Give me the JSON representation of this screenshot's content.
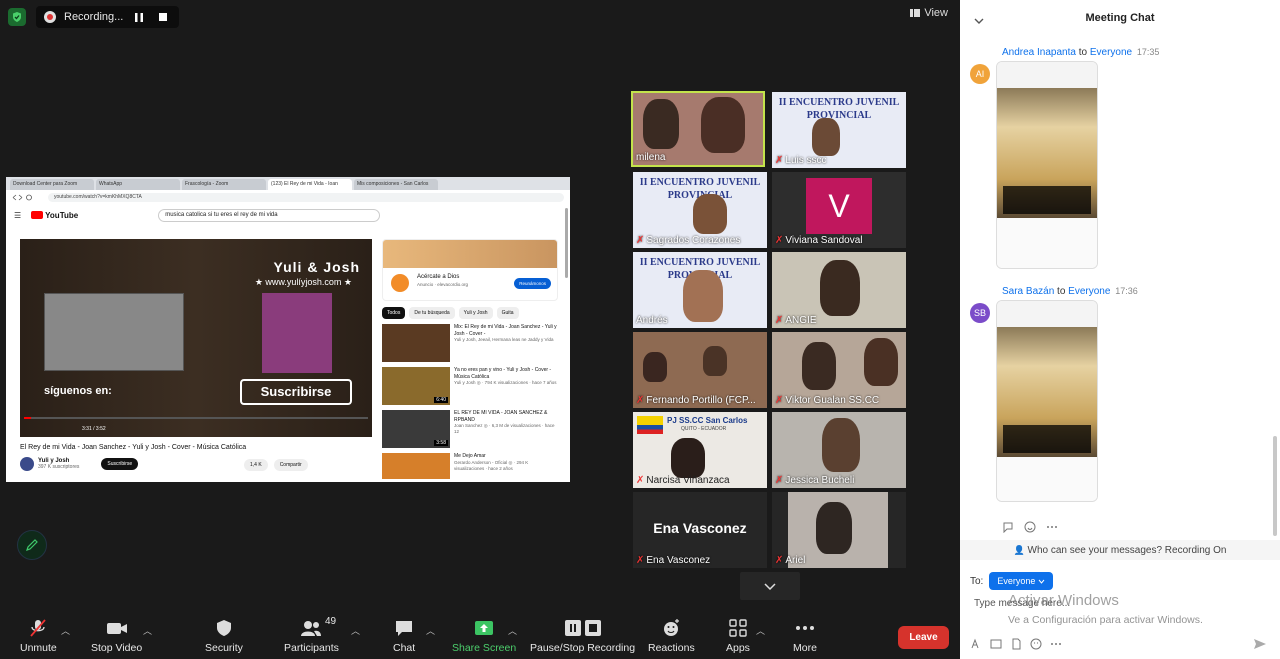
{
  "recording": {
    "label": "Recording..."
  },
  "view_label": "View",
  "browser": {
    "tabs": [
      "Download Center para Zoom",
      "WhatsApp",
      "Frascología - Zoom",
      "(123) El Rey de mi Vida - Ioan",
      "Mis composiciones - San Carlos"
    ],
    "url": "youtube.com/watch?v=kmKhMXQ8CTA"
  },
  "youtube": {
    "logo": "YouTube",
    "search": "musica catolica si tu eres el rey de mi vida",
    "video_overlay_title": "Yuli & Josh",
    "video_overlay_site": "★ www.yulíyjosh.com ★",
    "video_overlay_follow": "síguenos en:",
    "video_overlay_subscribe": "Suscribirse",
    "video_time": "3:31 / 3:52",
    "video_title": "El Rey de mi Vida - Joan Sanchez - Yuli y Josh - Cover - Música Católica",
    "channel": "Yuli y Josh",
    "subscribers": "397 K suscriptores",
    "subscribe_btn": "Suscribirse",
    "likes": "1,4 K",
    "share": "Compartir",
    "ad": {
      "title": "Acércate a Dios",
      "sub": "Anuncio · elevacordio.org",
      "button": "Reunámonos"
    },
    "chips": [
      "Todos",
      "De tu búsqueda",
      "Yuli y Josh",
      "Guita"
    ],
    "related": [
      {
        "title": "Mix: El Rey de mi Vida - Joan Sanchez - Yuli y Josh - Cover -",
        "meta": "Yuli y Josh, Jeeail, Hermana leas ne Jaddy y Vida"
      },
      {
        "title": "Ya no eres pan y vino - Yuli y Josh - Cover - Música Católica",
        "meta": "Yuli y Josh ◎ · 794 K visualizaciones · hace 7 años"
      },
      {
        "title": "EL REY DE MI VIDA - JOAN SANCHEZ & RPBAND",
        "meta": "Joan Sanchez ◎ · 6,3 M de visualizaciones · hace 12"
      },
      {
        "title": "Me Dejo Amar",
        "meta": "Gerardo Anderson - Oficial ◎ · 294 K visualizaciones · hace 2 años"
      }
    ],
    "related_durations": [
      "",
      "6:40",
      "3:58",
      ""
    ]
  },
  "gallery": [
    {
      "name": "milena",
      "active": true
    },
    {
      "name": "Luis sscc",
      "banner": "II ENCUENTRO JUVENIL PROVINCIAL"
    },
    {
      "name": "Sagrados Corazones",
      "banner": "II ENCUENTRO JUVENIL PROVINCIAL"
    },
    {
      "name": "Viviana Sandoval",
      "avatar": "V"
    },
    {
      "name": "Andrés",
      "banner": "II ENCUENTRO JUVENIL PROVINCIAL"
    },
    {
      "name": "ANGIE"
    },
    {
      "name": "Fernando Portillo (FCP..."
    },
    {
      "name": "Viktor Gualan SS.CC"
    },
    {
      "name": "Narcisa Viñanzaca",
      "banner": "PJ SS.CC San Carlos"
    },
    {
      "name": "Jessica Bucheli"
    },
    {
      "name": "Ena Vasconez",
      "center_text": "Ena Vasconez"
    },
    {
      "name": "Ariel"
    }
  ],
  "banner_sub": "QUITO - ECUADOR",
  "toolbar": {
    "unmute": "Unmute",
    "stop_video": "Stop Video",
    "security": "Security",
    "participants": "Participants",
    "participants_count": "49",
    "chat": "Chat",
    "share_screen": "Share Screen",
    "recording": "Pause/Stop Recording",
    "reactions": "Reactions",
    "apps": "Apps",
    "more": "More",
    "leave": "Leave"
  },
  "chat": {
    "title": "Meeting Chat",
    "messages": [
      {
        "initials": "AI",
        "sender": "Andrea Inapanta",
        "to_word": "to",
        "recipient": "Everyone",
        "time": "17:35",
        "color": "#f0a33a"
      },
      {
        "initials": "SB",
        "sender": "Sara Bazán",
        "to_word": "to",
        "recipient": "Everyone",
        "time": "17:36",
        "color": "#7b4cc9"
      }
    ],
    "notice": "Who can see your messages? Recording On",
    "to_label": "To:",
    "to_value": "Everyone",
    "placeholder": "Type message here...",
    "watermark_title": "Activar Windows",
    "watermark_sub": "Ve a Configuración para activar Windows."
  },
  "colors": {
    "accent": "#0e71eb",
    "leave": "#d6332c",
    "active_border": "#c3e34b",
    "share_green": "#4cce6c"
  }
}
